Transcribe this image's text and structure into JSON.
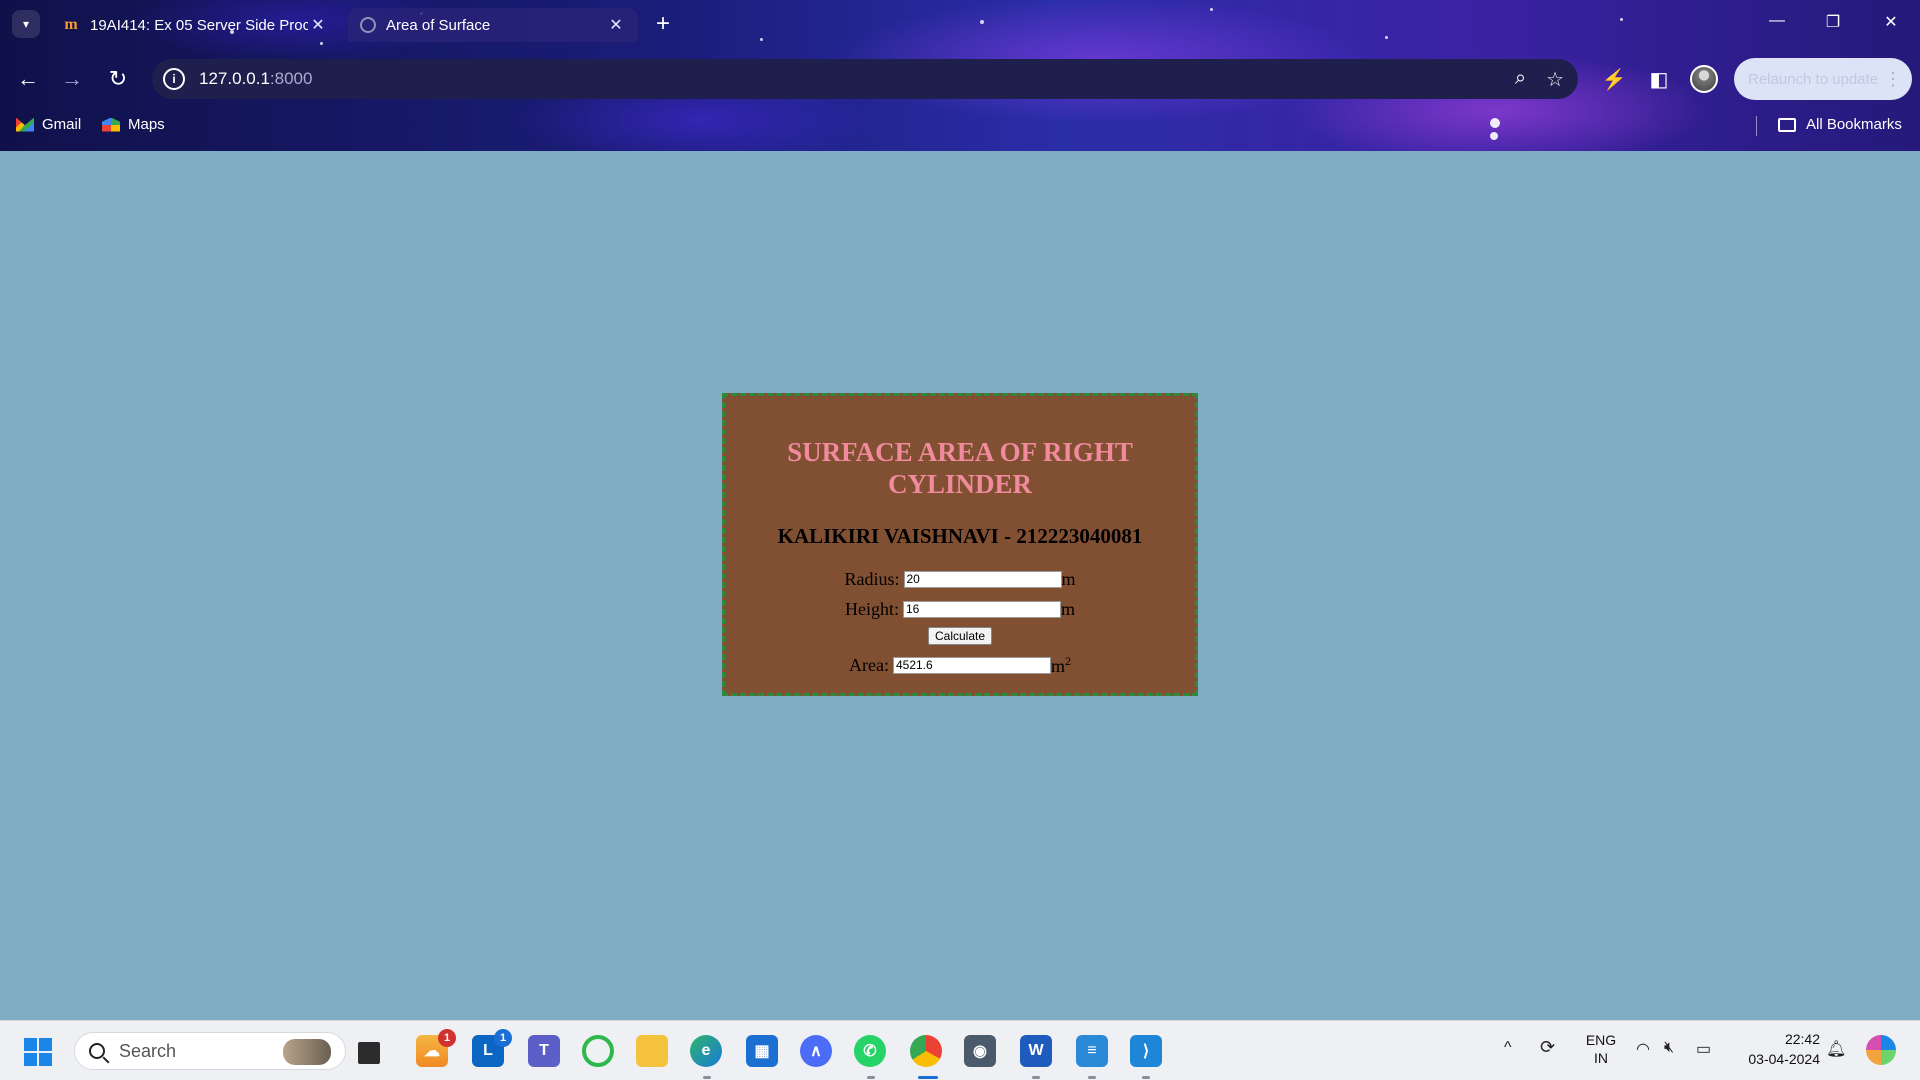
{
  "browser": {
    "tabs": [
      {
        "title": "19AI414: Ex 05 Server Side Proc",
        "active": false
      },
      {
        "title": "Area of Surface",
        "active": true
      }
    ],
    "url_host": "127.0.0.1",
    "url_port": ":8000",
    "relaunch_label": "Relaunch to update",
    "bookmarks": [
      {
        "label": "Gmail"
      },
      {
        "label": "Maps"
      }
    ],
    "all_bookmarks_label": "All Bookmarks"
  },
  "page": {
    "heading": "SURFACE AREA OF RIGHT CYLINDER",
    "subheading": "KALIKIRI VAISHNAVI - 212223040081",
    "radius_label": "Radius:",
    "radius_value": "20",
    "radius_unit": "m",
    "height_label": "Height:",
    "height_value": "16",
    "height_unit": "m",
    "calculate_label": "Calculate",
    "area_label": "Area:",
    "area_value": "4521.6",
    "area_unit": "m",
    "area_unit_exponent": "2",
    "colors": {
      "background": "#80adc5",
      "card": "#814f32",
      "card_border": "#2e8a3a",
      "heading": "#f08a9c"
    }
  },
  "taskbar": {
    "search_label": "Search",
    "apps": [
      "weather",
      "linkedin",
      "teams",
      "copilot-ring",
      "file-explorer",
      "edge",
      "store",
      "aws",
      "whatsapp",
      "chrome",
      "camera",
      "word",
      "notepad",
      "vscode"
    ],
    "weather_badge": "1",
    "linkedin_badge": "1",
    "lang_line1": "ENG",
    "lang_line2": "IN",
    "time": "22:42",
    "date": "03-04-2024"
  }
}
